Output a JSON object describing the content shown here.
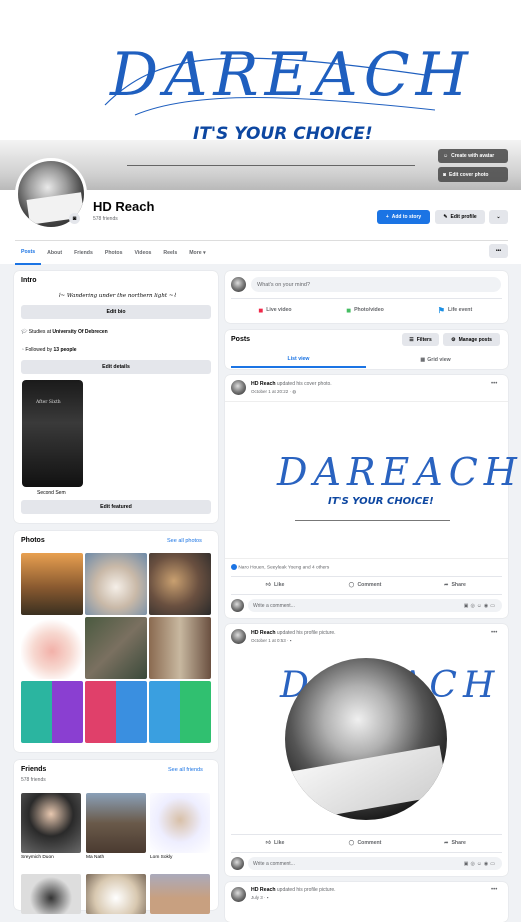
{
  "cover": {
    "signature": "DAREACH",
    "slogan": "IT'S YOUR CHOICE!",
    "btn_avatar": "Create with avatar",
    "btn_cover": "Edit cover photo"
  },
  "profile": {
    "name": "HD Reach",
    "friends_count": "578 friends",
    "add_story": "Add to story",
    "edit_profile": "Edit profile"
  },
  "tabs": [
    "Posts",
    "About",
    "Friends",
    "Photos",
    "Videos",
    "Reels",
    "More"
  ],
  "intro": {
    "title": "Intro",
    "bio": "Wandering under the northern light",
    "edit_bio": "Edit bio",
    "studies_prefix": "Studies at ",
    "studies_school": "University Of Debrecen",
    "followed_prefix": "Followed by ",
    "followed_count": "13 people",
    "edit_details": "Edit details",
    "featured_caption": "Second Sem",
    "featured_overlay": "After Sixth",
    "edit_featured": "Edit featured"
  },
  "photos": {
    "title": "Photos",
    "see_all": "See all photos"
  },
  "friends": {
    "title": "Friends",
    "count": "578 friends",
    "see_all": "See all friends",
    "items": [
      "Sreymich Duon",
      "Ma Nath",
      "Lom Sokly"
    ]
  },
  "composer": {
    "placeholder": "What's on your mind?",
    "live": "Live video",
    "photo": "Photo/video",
    "event": "Life event"
  },
  "posts_header": {
    "title": "Posts",
    "filters": "Filters",
    "manage": "Manage posts",
    "list_view": "List view",
    "grid_view": "Grid view"
  },
  "post1": {
    "author": "HD Reach",
    "action": " updated his cover photo.",
    "time": "October 1 at 20:22 · ",
    "signature": "DAREACH",
    "slogan": "IT'S YOUR CHOICE!",
    "reactions": "Naro Houen, Seeyleak Yoeng and 4 others"
  },
  "post2": {
    "author": "HD Reach",
    "action": " updated his profile picture.",
    "time": "October 1 at 0:53 · "
  },
  "post3": {
    "author": "HD Reach",
    "action": " updated his profile picture.",
    "time": "July 3 · "
  },
  "actions": {
    "like": "Like",
    "comment": "Comment",
    "share": "Share",
    "write": "Write a comment..."
  },
  "colors": {
    "accent": "#1b74e4",
    "cover_ink": "#1f5fbf",
    "slogan": "#0d47a1"
  }
}
